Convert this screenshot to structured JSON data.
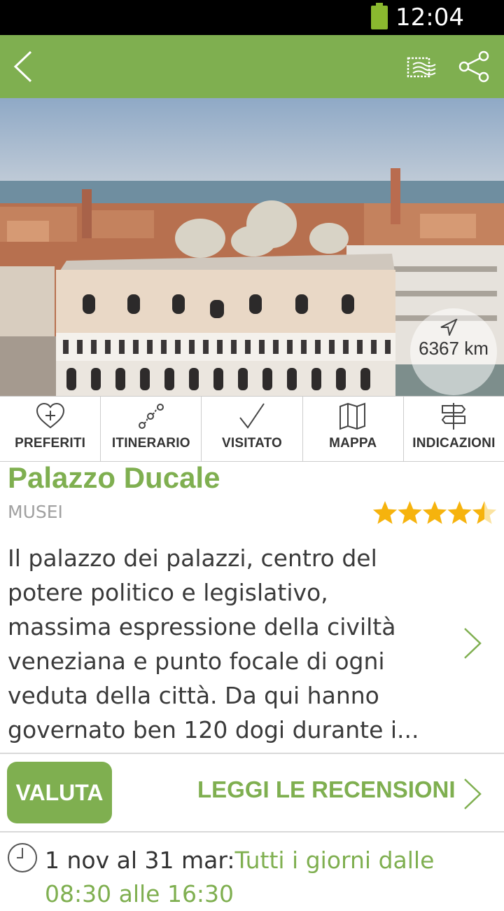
{
  "status_bar": {
    "time": "12:04 PM"
  },
  "app_bar": {
    "back_icon": "chevron-left-icon",
    "postcard_icon": "postcard-icon",
    "share_icon": "share-icon",
    "color": "#7faf50"
  },
  "hero": {
    "distance": "6367 km"
  },
  "actions": [
    {
      "label": "PREFERITI",
      "icon": "heart-plus-icon"
    },
    {
      "label": "ITINERARIO",
      "icon": "route-icon"
    },
    {
      "label": "VISITATO",
      "icon": "check-icon"
    },
    {
      "label": "MAPPA",
      "icon": "map-icon"
    },
    {
      "label": "INDICAZIONI",
      "icon": "signpost-icon"
    }
  ],
  "place": {
    "title": "Palazzo Ducale",
    "category": "MUSEI",
    "rating": 4.5,
    "description": "Il palazzo dei palazzi, centro del potere politico e legislativo, massima espressione della civiltà veneziana e punto focale di ogni veduta della città. Da qui hanno governato ben 120 dogi durante i..."
  },
  "reviews": {
    "rate_label": "VALUTA",
    "read_label": "LEGGI LE RECENSIONI"
  },
  "hours": {
    "period": "1 nov al 31 mar:",
    "times": "Tutti i giorni dalle 08:30 alle 16:30"
  },
  "colors": {
    "accent": "#7faf50",
    "star": "#f6b30d"
  }
}
